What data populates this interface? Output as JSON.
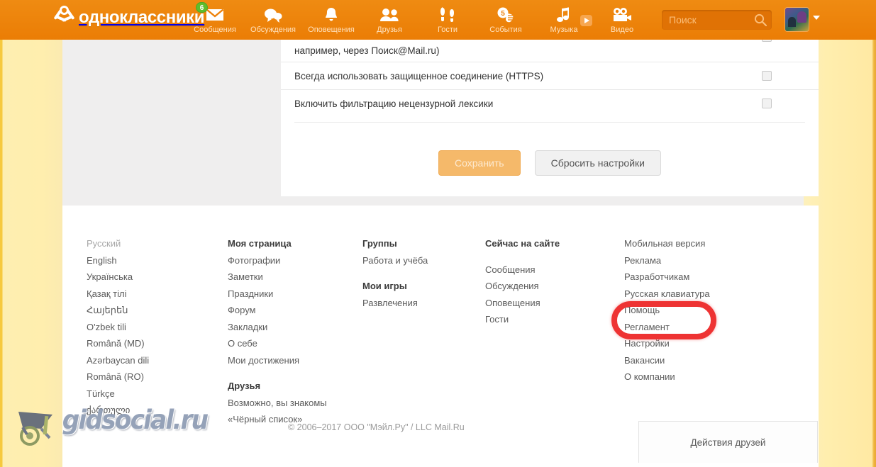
{
  "header": {
    "brand": "одноклассники",
    "nav": [
      {
        "label": "Сообщения",
        "icon": "envelope-icon",
        "badge": "6"
      },
      {
        "label": "Обсуждения",
        "icon": "chat-bubbles-icon",
        "badge": ""
      },
      {
        "label": "Оповещения",
        "icon": "bell-icon",
        "badge": ""
      },
      {
        "label": "Друзья",
        "icon": "people-icon",
        "badge": ""
      },
      {
        "label": "Гости",
        "icon": "footprints-icon",
        "badge": ""
      },
      {
        "label": "События",
        "icon": "calendar-hand-icon",
        "badge": ""
      },
      {
        "label": "Музыка",
        "icon": "music-note-icon",
        "badge": ""
      },
      {
        "label": "Видео",
        "icon": "video-camera-icon",
        "badge": ""
      }
    ],
    "search": {
      "value": "",
      "placeholder": "Поиск",
      "icon": "search-icon"
    },
    "avatar_alt": "avatar",
    "caret": "▼"
  },
  "settings": {
    "rows": [
      {
        "label": "например, через Поиск@Mail.ru)",
        "checked": true,
        "partial": true
      },
      {
        "label": "Всегда использовать защищенное соединение (HTTPS)",
        "checked": false,
        "partial": false
      },
      {
        "label": "Включить фильтрацию нецензурной лексики",
        "checked": false,
        "partial": false
      }
    ],
    "save_label": "Сохранить",
    "reset_label": "Сбросить настройки"
  },
  "footer": {
    "columns": [
      {
        "name": "languages",
        "items": [
          {
            "label": "Русский",
            "style": "muted"
          },
          {
            "label": "English",
            "style": "link"
          },
          {
            "label": "Українська",
            "style": "link"
          },
          {
            "label": "Қазақ тілі",
            "style": "link"
          },
          {
            "label": "Հայերեն",
            "style": "link"
          },
          {
            "label": "O'zbek tili",
            "style": "link"
          },
          {
            "label": "Română (MD)",
            "style": "link"
          },
          {
            "label": "Azərbaycan dili",
            "style": "link"
          },
          {
            "label": "Română (RO)",
            "style": "link"
          },
          {
            "label": "Türkçe",
            "style": "link"
          },
          {
            "label": "ქართული",
            "style": "link"
          }
        ]
      },
      {
        "name": "my-page",
        "items": [
          {
            "label": "Моя страница",
            "style": "head"
          },
          {
            "label": "Фотографии",
            "style": "link"
          },
          {
            "label": "Заметки",
            "style": "link"
          },
          {
            "label": "Праздники",
            "style": "link"
          },
          {
            "label": "Форум",
            "style": "link"
          },
          {
            "label": "Закладки",
            "style": "link"
          },
          {
            "label": "О себе",
            "style": "link"
          },
          {
            "label": "Мои достижения",
            "style": "link"
          },
          {
            "label": "Друзья",
            "style": "head-gap"
          },
          {
            "label": "Возможно, вы знакомы",
            "style": "link"
          },
          {
            "label": "«Чёрный список»",
            "style": "link"
          }
        ]
      },
      {
        "name": "groups-games",
        "items": [
          {
            "label": "Группы",
            "style": "head"
          },
          {
            "label": "Работа и учёба",
            "style": "link"
          },
          {
            "label": "Мои игры",
            "style": "head-gap"
          },
          {
            "label": "Развлечения",
            "style": "link"
          }
        ]
      },
      {
        "name": "now-on-site",
        "items": [
          {
            "label": "Сейчас на сайте",
            "style": "head"
          },
          {
            "label": "Сообщения",
            "style": "link-gap"
          },
          {
            "label": "Обсуждения",
            "style": "link"
          },
          {
            "label": "Оповещения",
            "style": "link"
          },
          {
            "label": "Гости",
            "style": "link"
          }
        ]
      },
      {
        "name": "service",
        "items": [
          {
            "label": "Мобильная версия",
            "style": "link"
          },
          {
            "label": "Реклама",
            "style": "link"
          },
          {
            "label": "Разработчикам",
            "style": "link"
          },
          {
            "label": "Русская клавиатура",
            "style": "link"
          },
          {
            "label": "Помощь",
            "style": "link"
          },
          {
            "label": "Регламент",
            "style": "link"
          },
          {
            "label": "Настройки",
            "style": "link"
          },
          {
            "label": "Вакансии",
            "style": "link"
          },
          {
            "label": "О компании",
            "style": "link"
          }
        ]
      }
    ],
    "copyright": "© 2006–2017 ООО \"Мэйл.Ру\" / LLC Mail.Ru",
    "actions_box_label": "Действия друзей"
  },
  "annotation": {
    "type": "red-oval-highlight",
    "target_label": "Регламент",
    "color": "#ee3333"
  },
  "watermark": {
    "text": "gidsocial.ru",
    "icon": "wheelbarrow-icon"
  },
  "colors": {
    "brand_orange": "#ed8008",
    "page_yellow": "#ffeeae",
    "content_grey": "#efeeee",
    "badge_green": "#5fbd2c",
    "annotation_red": "#ee3333"
  }
}
